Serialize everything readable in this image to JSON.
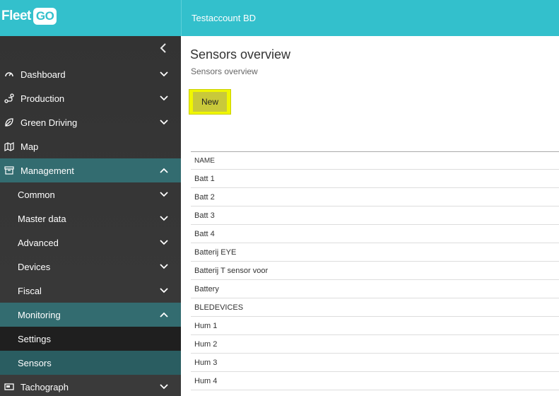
{
  "brand": {
    "fleet": "Fleet",
    "go": "GO"
  },
  "header": {
    "account": "Testaccount BD"
  },
  "sidebar": {
    "items": [
      {
        "label": "Dashboard",
        "icon": "gauge-icon",
        "chevron": "down"
      },
      {
        "label": "Production",
        "icon": "route-icon",
        "chevron": "down"
      },
      {
        "label": "Green Driving",
        "icon": "leaf-icon",
        "chevron": "down"
      },
      {
        "label": "Map",
        "icon": "map-icon",
        "chevron": ""
      },
      {
        "label": "Management",
        "icon": "archive-icon",
        "chevron": "up"
      },
      {
        "label": "Common",
        "chevron": "down"
      },
      {
        "label": "Master data",
        "chevron": "down"
      },
      {
        "label": "Advanced",
        "chevron": "down"
      },
      {
        "label": "Devices",
        "chevron": "down"
      },
      {
        "label": "Fiscal",
        "chevron": "down"
      },
      {
        "label": "Monitoring",
        "chevron": "up"
      },
      {
        "label": "Settings",
        "chevron": ""
      },
      {
        "label": "Sensors",
        "chevron": ""
      },
      {
        "label": "Tachograph",
        "icon": "tachograph-icon",
        "chevron": "down"
      }
    ]
  },
  "page": {
    "title": "Sensors overview",
    "subtitle": "Sensors overview",
    "new_label": "New"
  },
  "table": {
    "header": "NAME",
    "rows": [
      "Batt 1",
      "Batt 2",
      "Batt 3",
      "Batt 4",
      "Batterij EYE",
      "Batterij T sensor voor",
      "Battery",
      "BLEDEVICES",
      "Hum 1",
      "Hum 2",
      "Hum 3",
      "Hum 4"
    ]
  },
  "colors": {
    "accent": "#33c0cc",
    "sidebar": "#333333",
    "active_section": "#336c70",
    "highlight": "#f0f600"
  }
}
